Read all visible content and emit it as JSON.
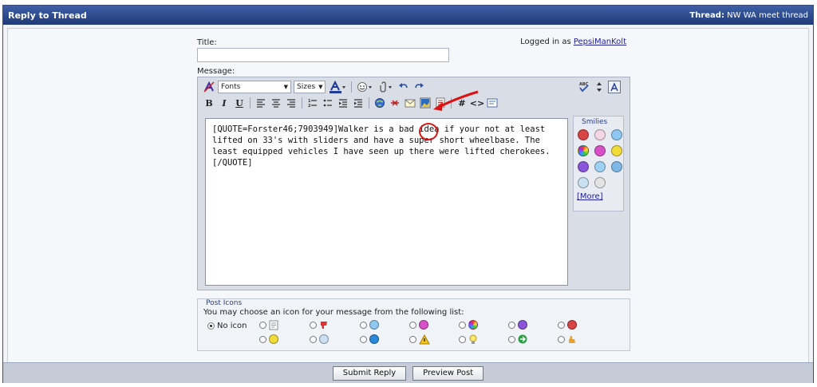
{
  "header": {
    "title": "Reply to Thread",
    "thread_label": "Thread:",
    "thread_name": "NW WA meet thread"
  },
  "form": {
    "title_label": "Title:",
    "title_value": "",
    "logged_prefix": "Logged in as",
    "username": "PepsiManKolt",
    "message_label": "Message:"
  },
  "toolbar": {
    "font_select": "Fonts",
    "size_select": "Sizes",
    "bold": "B",
    "italic": "I",
    "underline": "U",
    "hash": "#",
    "code": "<>"
  },
  "message_text": "[QUOTE=Forster46;7903949]Walker is a bad idea if your not at least lifted on 33's with sliders and have a super short wheelbase. The least equipped vehicles I have seen up there were lifted cherokees.[/QUOTE]",
  "smilies": {
    "title": "Smilies",
    "more_label": "[More]",
    "items": [
      "mad",
      "biggrin",
      "wink",
      "cool-rainbow",
      "smile-purple",
      "smile",
      "frown",
      "confused",
      "roll",
      "sunglasses",
      "eek"
    ]
  },
  "post_icons": {
    "legend": "Post Icons",
    "description": "You may choose an icon for your message from the following list:",
    "no_icon_label": "No icon",
    "selected": "No icon"
  },
  "buttons": {
    "submit": "Submit Reply",
    "preview": "Preview Post"
  },
  "colors": {
    "header_bg": "#1f3a78",
    "accent_red": "#d11111",
    "link": "#22229c"
  }
}
